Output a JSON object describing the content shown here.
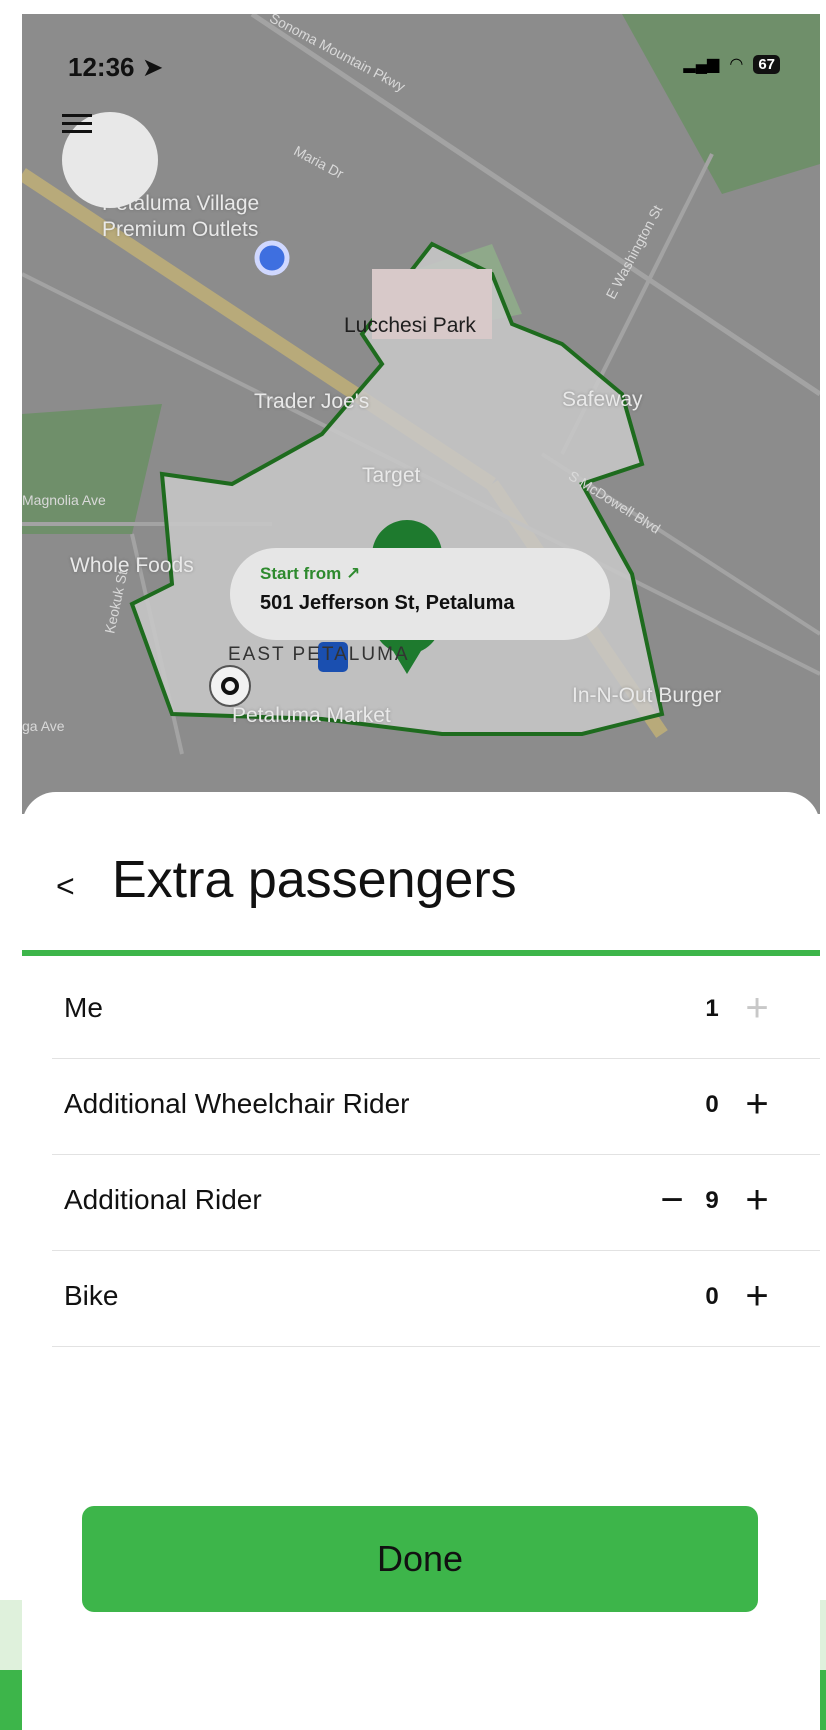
{
  "status_bar": {
    "time": "12:36",
    "battery": "67"
  },
  "map": {
    "labels": {
      "outlets_line1": "Petaluma Village",
      "outlets_line2": "Premium Outlets",
      "lucchesi_park": "Lucchesi Park",
      "trader_joes": "Trader Joe's",
      "safeway": "Safeway",
      "target": "Target",
      "whole_foods": "Whole Foods",
      "east_petaluma": "EAST PETALUMA",
      "petaluma_market": "Petaluma Market",
      "in_n_out": "In-N-Out Burger",
      "street_mountain": "Sonoma Mountain Pkwy",
      "street_maria": "Maria Dr",
      "street_washington": "E Washington St",
      "street_mcdowell": "S McDowell Blvd",
      "street_magnolia": "Magnolia Ave",
      "street_keokuk": "Keokuk St",
      "street_ave": "ga Ave"
    },
    "start_card": {
      "label": "Start from ↗",
      "address": "501 Jefferson St, Petaluma"
    }
  },
  "sheet": {
    "title": "Extra passengers",
    "rows": [
      {
        "label": "Me",
        "count": "1"
      },
      {
        "label": "Additional Wheelchair Rider",
        "count": "0"
      },
      {
        "label": "Additional Rider",
        "count": "9"
      },
      {
        "label": "Bike",
        "count": "0"
      }
    ],
    "done_label": "Done"
  },
  "icons": {
    "back": "chevron-left-icon",
    "menu": "hamburger-menu-icon",
    "location": "location-arrow-icon"
  },
  "colors": {
    "accent": "#3db54a",
    "map_bg": "#8c8c8c",
    "zone_outline": "#1e6b1e"
  }
}
